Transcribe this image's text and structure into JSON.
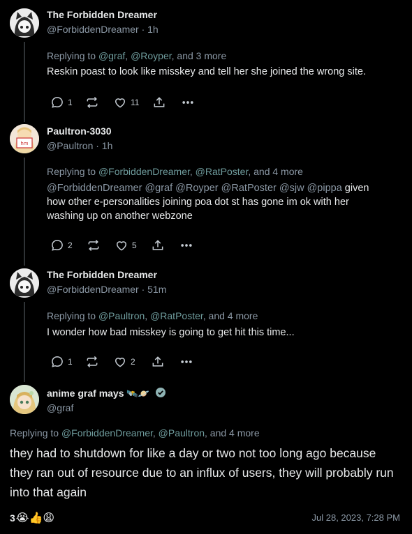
{
  "posts": [
    {
      "name": "The Forbidden Dreamer",
      "handle": "@ForbiddenDreamer · 1h",
      "replying_prefix": "Replying to ",
      "replying_mentions": [
        "@graf",
        "@Royper"
      ],
      "replying_sep": ", ",
      "replying_suffix": ", and 3 more",
      "body_text": "Reskin poast to look like misskey and tell her she joined the wrong site.",
      "replies": "1",
      "reposts": "",
      "likes": "11"
    },
    {
      "name": "Paultron-3030",
      "handle": "@Paultron · 1h",
      "replying_prefix": "Replying to ",
      "replying_mentions": [
        "@ForbiddenDreamer",
        "@RatPoster"
      ],
      "replying_sep": ", ",
      "replying_suffix": ", and 4 more",
      "body_mentions": "@ForbiddenDreamer @graf @Royper @RatPoster @sjw @pippa",
      "body_line1": " given",
      "body_line2": "how other e-personalities joining poa dot st has gone im ok with her",
      "body_line3": "washing up on another webzone",
      "replies": "2",
      "reposts": "",
      "likes": "5"
    },
    {
      "name": "The Forbidden Dreamer",
      "handle": "@ForbiddenDreamer · 51m",
      "replying_prefix": "Replying to ",
      "replying_mentions": [
        "@Paultron",
        "@RatPoster"
      ],
      "replying_sep": ", ",
      "replying_suffix": ", and 4 more",
      "body_text": "I wonder how bad misskey is going to get hit this time...",
      "replies": "1",
      "reposts": "",
      "likes": "2"
    }
  ],
  "main": {
    "name": "anime graf mays",
    "name_emoji": "🛰️🪐",
    "handle": "@graf",
    "replying_prefix": "Replying to ",
    "replying_mentions": [
      "@ForbiddenDreamer",
      "@Paultron"
    ],
    "replying_sep": ", ",
    "replying_suffix": ", and 4 more",
    "body": "they had to shutdown for like a day or two not too long ago because they ran out of resource due to an influx of users, they will probably run into that again",
    "reaction_count": "3",
    "reaction_emojis": "😭👍😩",
    "timestamp": "Jul 28, 2023, 7:28 PM"
  },
  "colors": {
    "background": "#000000",
    "text": "#e7e9ea",
    "muted": "#8b98a5",
    "mention": "#6f9c9d",
    "verified": "#8fb3b4"
  }
}
